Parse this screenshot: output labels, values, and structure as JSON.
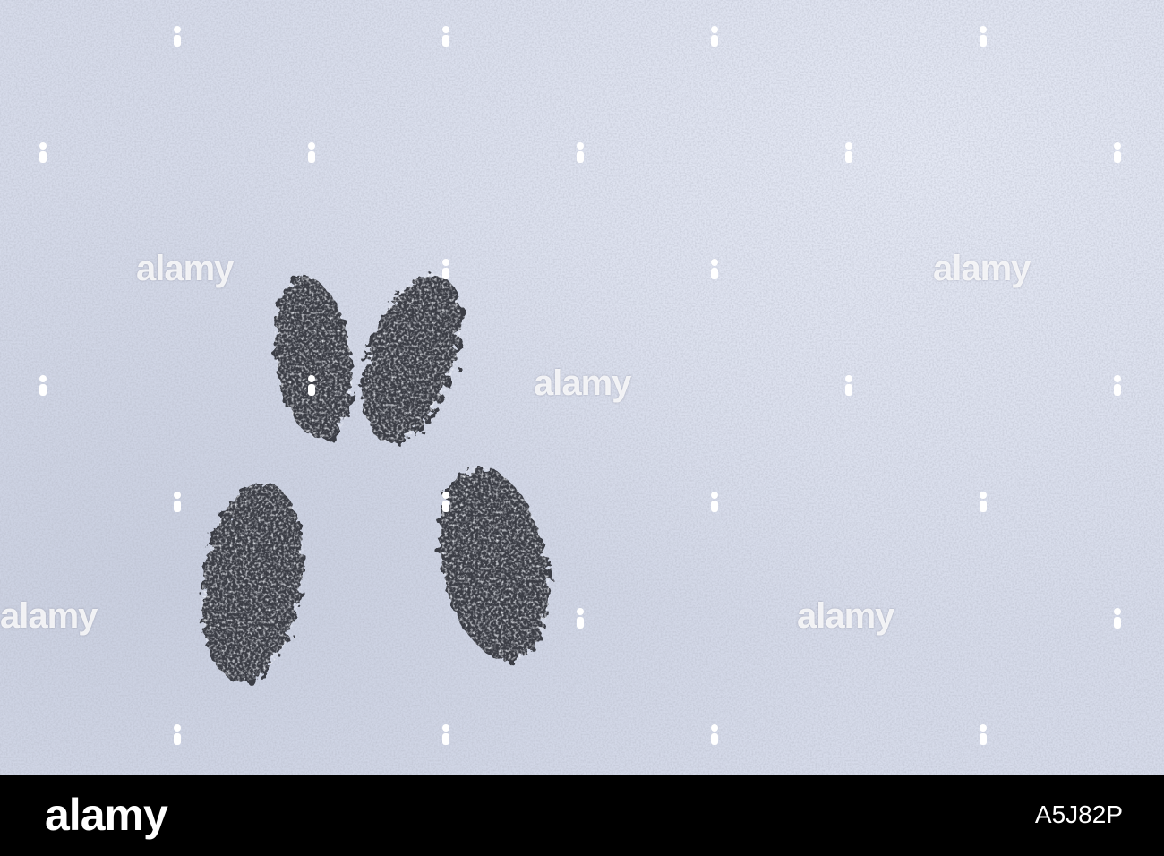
{
  "scene": {
    "subject": "track-prints-in-snow",
    "colors": {
      "snow": "#d6dbea",
      "print": "#3b3e44",
      "bar": "#000000"
    }
  },
  "watermark": {
    "text": "alamy"
  },
  "footer": {
    "logo": "alamy",
    "image_id": "A5J82P"
  }
}
